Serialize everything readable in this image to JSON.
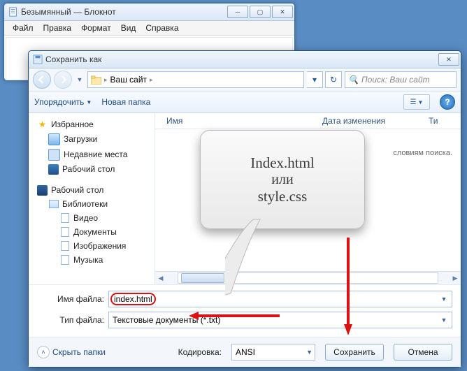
{
  "notepad": {
    "title": "Безымянный — Блокнот",
    "menu": {
      "file": "Файл",
      "edit": "Правка",
      "format": "Формат",
      "view": "Вид",
      "help": "Справка"
    }
  },
  "dialog": {
    "title": "Сохранить как",
    "breadcrumb": {
      "root": "",
      "folder": "Ваш сайт"
    },
    "search_placeholder": "Поиск: Ваш сайт",
    "toolbar": {
      "organize": "Упорядочить",
      "newfolder": "Новая папка"
    },
    "columns": {
      "name": "Имя",
      "date": "Дата изменения",
      "type": "Ти"
    },
    "empty_msg": "словиям поиска.",
    "tree": {
      "favorites": "Избранное",
      "downloads": "Загрузки",
      "recent": "Недавние места",
      "desktop": "Рабочий стол",
      "desktop2": "Рабочий стол",
      "libraries": "Библиотеки",
      "videos": "Видео",
      "documents": "Документы",
      "pictures": "Изображения",
      "music": "Музыка"
    },
    "labels": {
      "filename": "Имя файла:",
      "filetype": "Тип файла:",
      "encoding": "Кодировка:",
      "hide": "Скрыть папки"
    },
    "values": {
      "filename": "index.html",
      "filetype": "Текстовые документы (*.txt)",
      "encoding": "ANSI"
    },
    "buttons": {
      "save": "Сохранить",
      "cancel": "Отмена"
    }
  },
  "callout": {
    "l1": "Index.html",
    "l2": "или",
    "l3": "style.css"
  }
}
